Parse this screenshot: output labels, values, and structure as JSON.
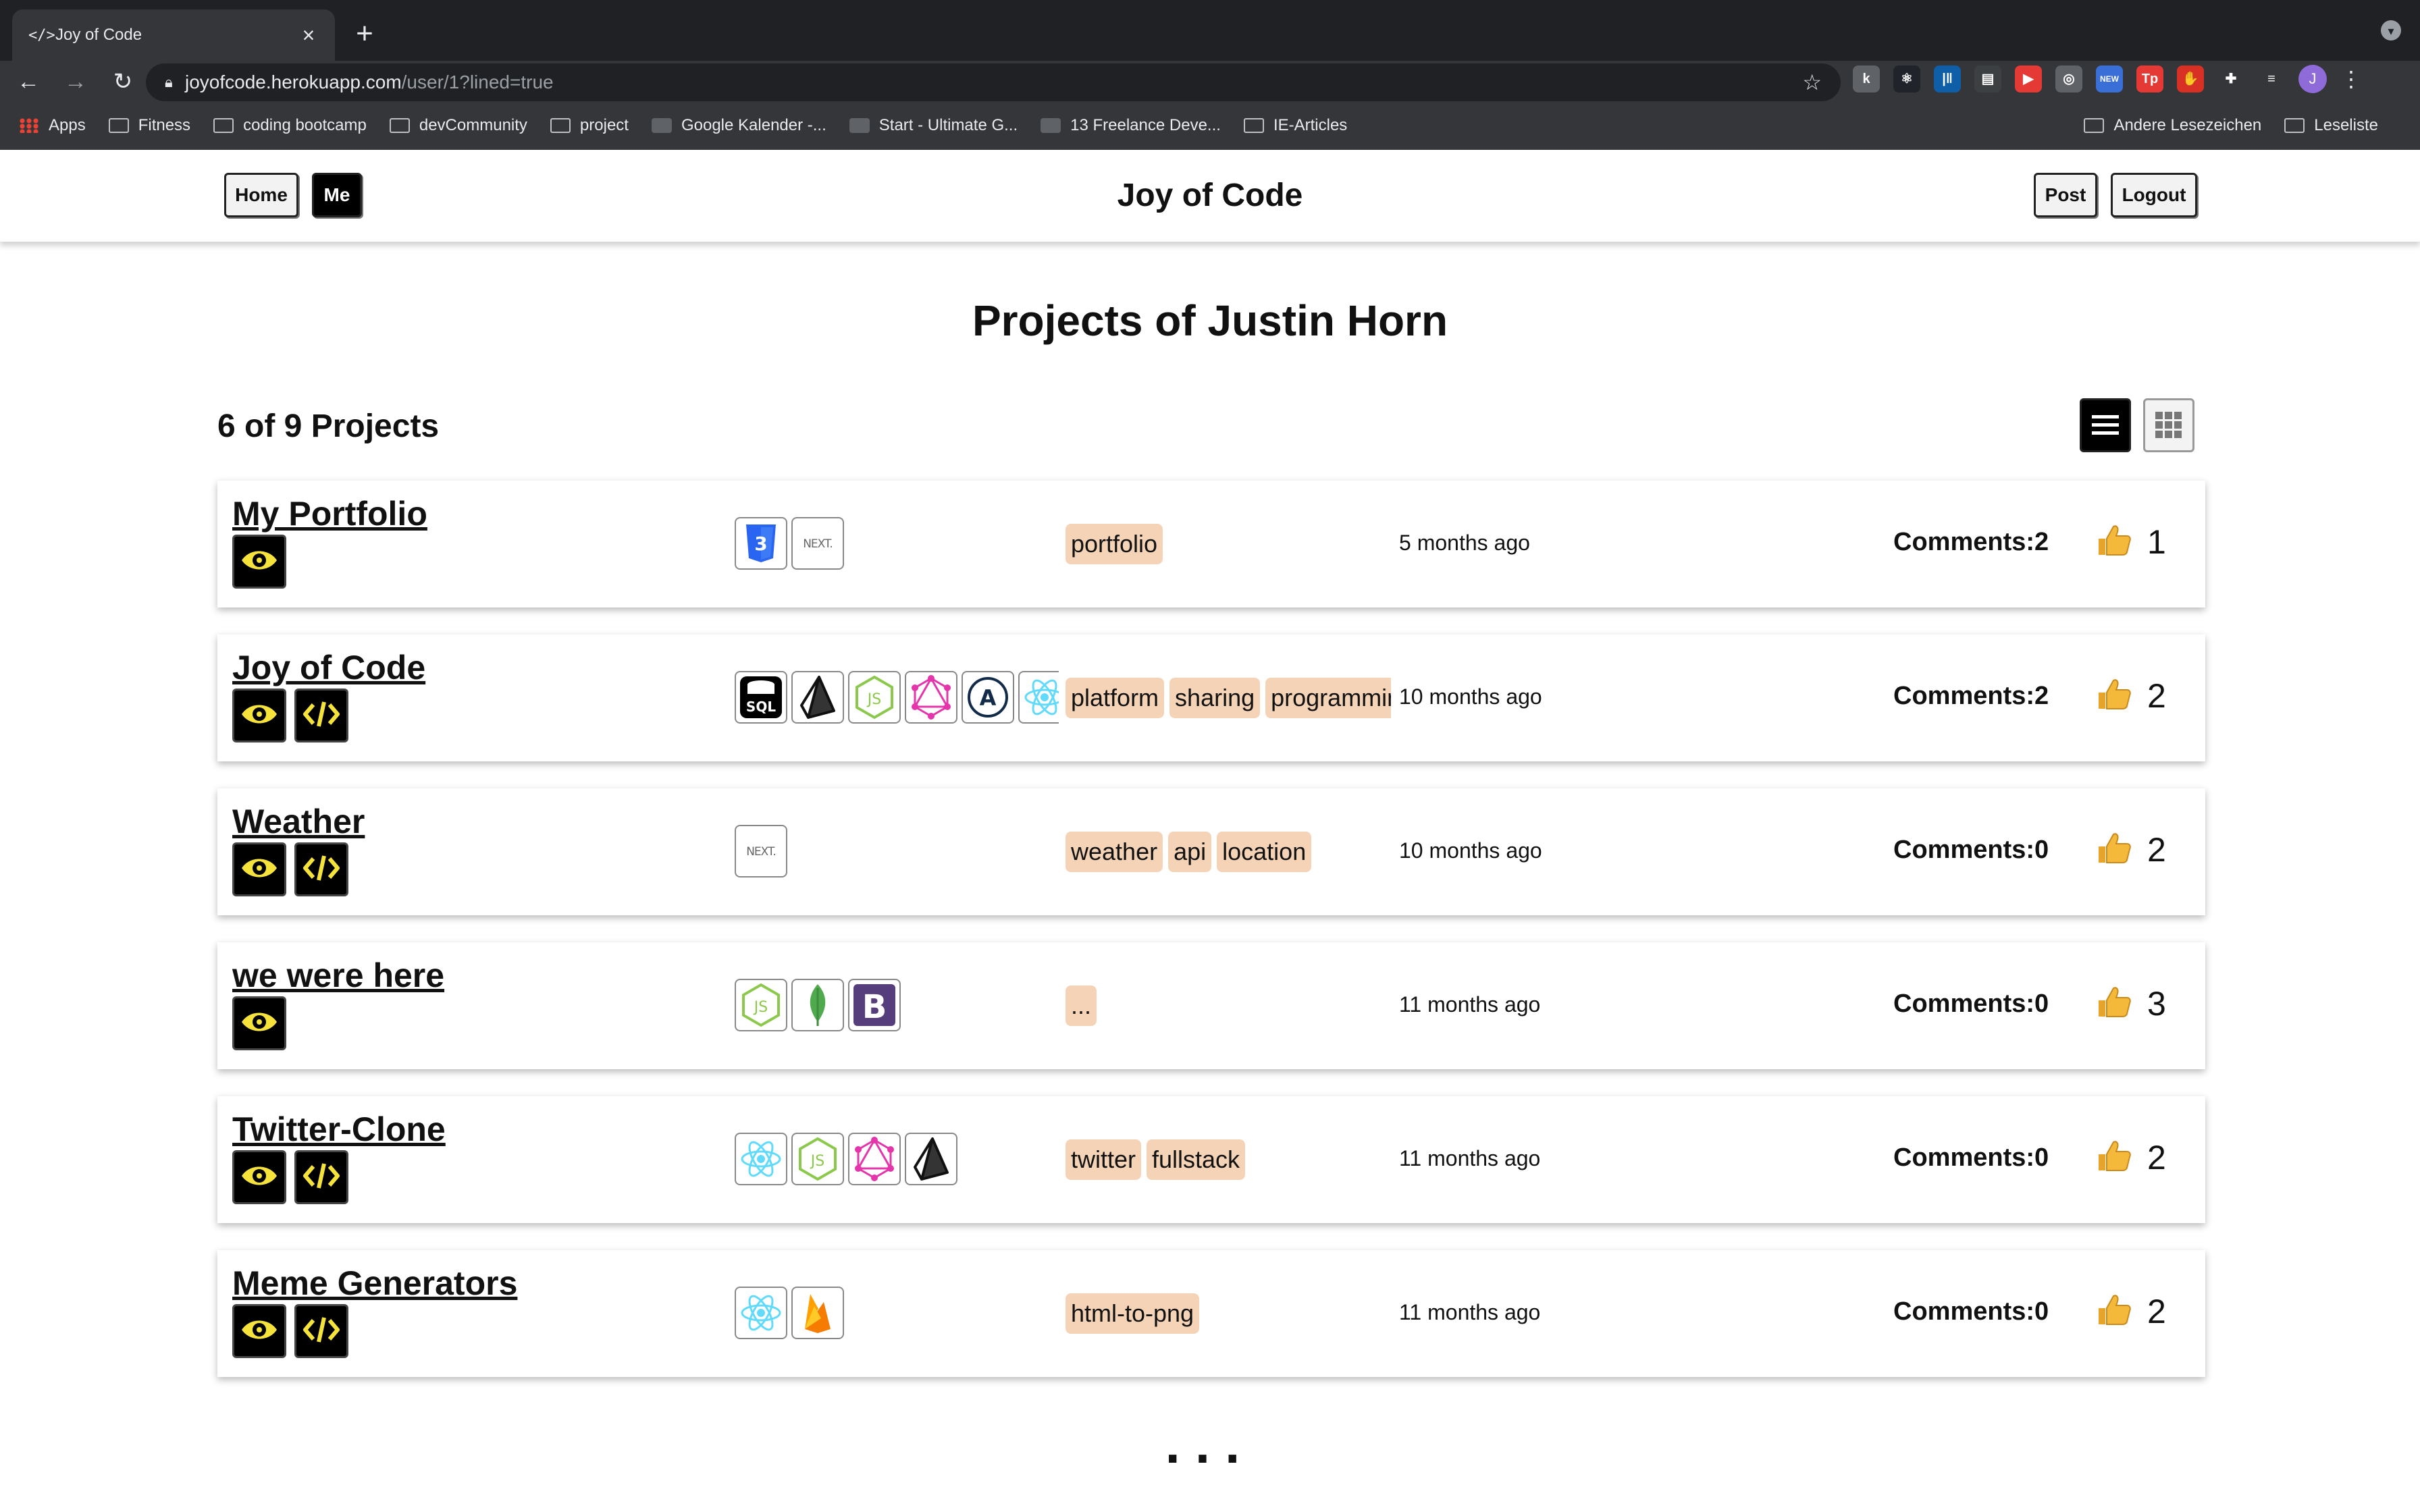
{
  "browser": {
    "tab_title": "Joy of Code",
    "tab_icon": "</>",
    "url_host": "joyofcode.herokuapp.com",
    "url_path": "/user/1?lined=true",
    "profile_initial": "J",
    "extensions": [
      {
        "name": "ext-k-icon",
        "label": "k",
        "color": "#5f6368"
      },
      {
        "name": "react-devtools-icon",
        "label": "⚛",
        "color": "#20232a"
      },
      {
        "name": "ext-bars-icon",
        "label": "|‖",
        "color": "#0f5fa8"
      },
      {
        "name": "ext-paper-icon",
        "label": "▤",
        "color": "#3c4043"
      },
      {
        "name": "ext-play-icon",
        "label": "▶",
        "color": "#e53935"
      },
      {
        "name": "ext-globe-icon",
        "label": "◎",
        "color": "#5f6368"
      },
      {
        "name": "ext-new-icon",
        "label": "NEW",
        "color": "#3b6fd8"
      },
      {
        "name": "ext-tp-icon",
        "label": "Tp",
        "color": "#e53935"
      },
      {
        "name": "ext-hand-icon",
        "label": "✋",
        "color": "#d93025"
      },
      {
        "name": "extensions-puzzle-icon",
        "label": "✚",
        "color": "#35363a"
      },
      {
        "name": "reading-list-icon",
        "label": "≡",
        "color": "#35363a"
      }
    ],
    "bookmarks": [
      {
        "label": "Apps",
        "icon": "apps-grid-icon"
      },
      {
        "label": "Fitness",
        "icon": "folder-icon"
      },
      {
        "label": "coding bootcamp",
        "icon": "folder-icon"
      },
      {
        "label": "devCommunity",
        "icon": "folder-icon"
      },
      {
        "label": "project",
        "icon": "folder-icon"
      },
      {
        "label": "Google Kalender -...",
        "icon": "calendar-favicon"
      },
      {
        "label": "Start - Ultimate G...",
        "icon": "favicon"
      },
      {
        "label": "13 Freelance Deve...",
        "icon": "favicon"
      },
      {
        "label": "IE-Articles",
        "icon": "folder-icon"
      }
    ],
    "bookmarks_right": [
      {
        "label": "Andere Lesezeichen",
        "icon": "folder-icon"
      },
      {
        "label": "Leseliste",
        "icon": "reading-list-icon"
      }
    ]
  },
  "header": {
    "home_label": "Home",
    "me_label": "Me",
    "title": "Joy of Code",
    "post_label": "Post",
    "logout_label": "Logout"
  },
  "main": {
    "title": "Projects of Justin Horn",
    "count": "6 of 9 Projects",
    "more": "..."
  },
  "projects": [
    {
      "title": "My Portfolio",
      "code": false,
      "techs": [
        "css3",
        "nextjs"
      ],
      "tags": [
        "portfolio"
      ],
      "ago": "5 months ago",
      "comments": "Comments:2",
      "likes": "1"
    },
    {
      "title": "Joy of Code",
      "code": true,
      "techs": [
        "sql",
        "prisma",
        "nodejs",
        "graphql",
        "apollo",
        "react"
      ],
      "tags": [
        "platform",
        "sharing",
        "programmin"
      ],
      "ago": "10 months ago",
      "comments": "Comments:2",
      "likes": "2"
    },
    {
      "title": "Weather",
      "code": true,
      "techs": [
        "nextjs"
      ],
      "tags": [
        "weather",
        "api",
        "location"
      ],
      "ago": "10 months ago",
      "comments": "Comments:0",
      "likes": "2"
    },
    {
      "title": "we were here",
      "code": false,
      "techs": [
        "nodejs",
        "mongodb",
        "bootstrap"
      ],
      "tags": [
        "..."
      ],
      "ago": "11 months ago",
      "comments": "Comments:0",
      "likes": "3"
    },
    {
      "title": "Twitter-Clone",
      "code": true,
      "techs": [
        "react",
        "nodejs",
        "graphql",
        "prisma"
      ],
      "tags": [
        "twitter",
        "fullstack"
      ],
      "ago": "11 months ago",
      "comments": "Comments:0",
      "likes": "2"
    },
    {
      "title": "Meme Generators",
      "code": true,
      "techs": [
        "react",
        "firebase"
      ],
      "tags": [
        "html-to-png"
      ],
      "ago": "11 months ago",
      "comments": "Comments:0",
      "likes": "2"
    }
  ],
  "colors": {
    "tag_bg": "#f5d3b6",
    "icon_yellow": "#f5e33b",
    "thumb": "#f4b83a"
  }
}
